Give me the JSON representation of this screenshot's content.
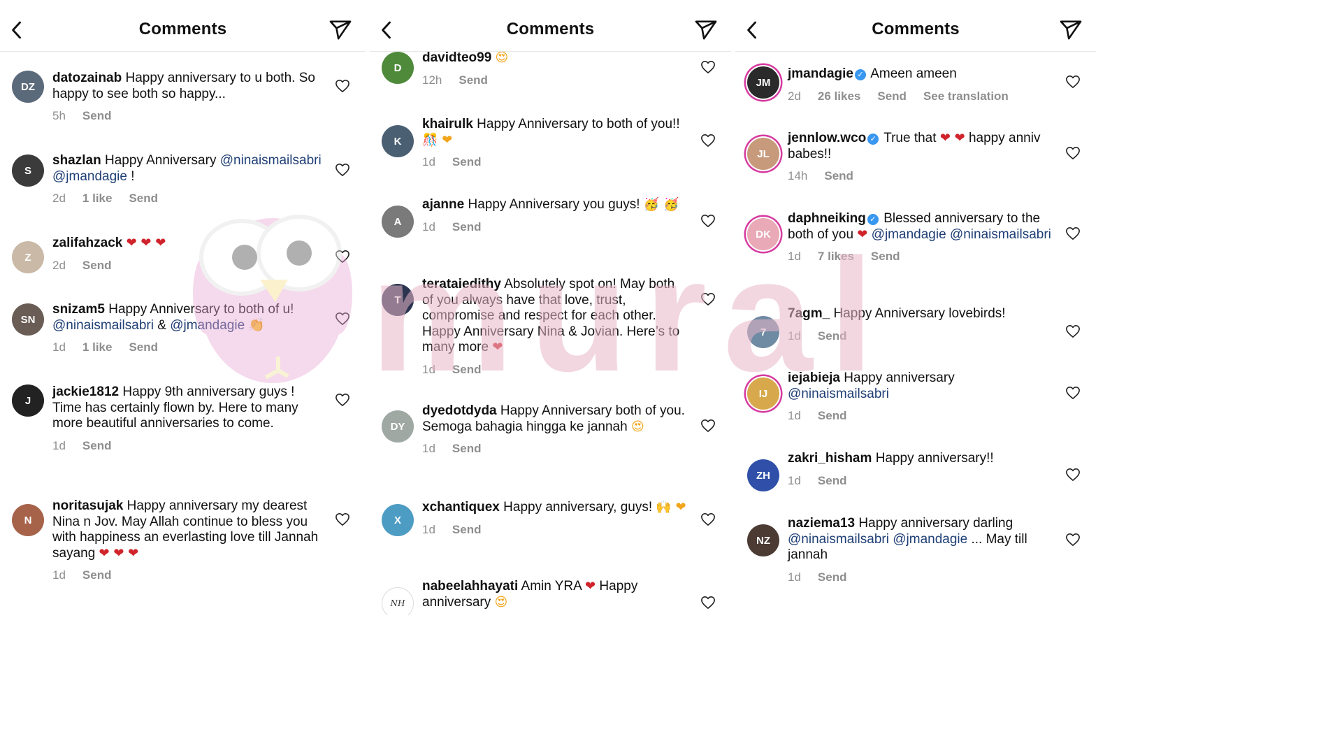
{
  "header": {
    "title": "Comments"
  },
  "panels": [
    {
      "comments": [
        {
          "user": "datozainab",
          "parts": [
            {
              "t": "Happy anniversary to u both. So happy to see both so happy..."
            }
          ],
          "meta": [
            "5h",
            "Send"
          ],
          "avatar": {
            "initials": "DZ",
            "color": "#5b6a7a"
          }
        },
        {
          "user": "shazlan",
          "parts": [
            {
              "t": "Happy Anniversary "
            },
            {
              "m": "@ninaismailsabri"
            },
            {
              "t": " "
            },
            {
              "m": "@jmandagie"
            },
            {
              "t": " !"
            }
          ],
          "meta": [
            "2d",
            "1 like",
            "Send"
          ],
          "avatar": {
            "initials": "S",
            "color": "#3b3b3b"
          }
        },
        {
          "user": "zalifahzack",
          "parts": [
            {
              "e": "❤ ❤ ❤"
            }
          ],
          "meta": [
            "2d",
            "Send"
          ],
          "avatar": {
            "initials": "Z",
            "color": "#c9b9a6"
          }
        },
        {
          "user": "snizam5",
          "parts": [
            {
              "t": "Happy Anniversary to both of u! "
            },
            {
              "m": "@ninaismailsabri"
            },
            {
              "t": " & "
            },
            {
              "m": "@jmandagie"
            },
            {
              "t": " 👏"
            }
          ],
          "meta": [
            "1d",
            "1 like",
            "Send"
          ],
          "avatar": {
            "initials": "SN",
            "color": "#6a5d55"
          }
        },
        {
          "user": "jackie1812",
          "parts": [
            {
              "t": "Happy 9th anniversary guys ! Time has certainly flown by. Here to many more beautiful anniversaries to come."
            }
          ],
          "meta": [
            "1d",
            "Send"
          ],
          "avatar": {
            "initials": "J",
            "color": "#222222"
          }
        },
        {
          "user": "noritasujak",
          "parts": [
            {
              "t": "Happy anniversary my dearest Nina n Jov. May Allah continue to bless you with happiness an everlasting love till Jannah sayang "
            },
            {
              "e": "❤ ❤ ❤"
            }
          ],
          "meta": [
            "1d",
            "Send"
          ],
          "avatar": {
            "initials": "N",
            "color": "#a6634a"
          }
        }
      ]
    },
    {
      "comments": [
        {
          "user": "davidteo99",
          "parts": [
            {
              "e": "😍"
            }
          ],
          "meta": [
            "12h",
            "Send"
          ],
          "avatar": {
            "initials": "D",
            "color": "#4f8a3b"
          }
        },
        {
          "user": "khairulk",
          "parts": [
            {
              "t": "Happy Anniversary to both of you!! "
            },
            {
              "e": "🎊 ❤"
            }
          ],
          "meta": [
            "1d",
            "Send"
          ],
          "avatar": {
            "initials": "K",
            "color": "#4a6072"
          }
        },
        {
          "user": "ajanne",
          "parts": [
            {
              "t": "Happy Anniversary you guys! "
            },
            {
              "e": "🥳 🥳"
            }
          ],
          "meta": [
            "1d",
            "Send"
          ],
          "avatar": {
            "initials": "A",
            "color": "#7a7a7a"
          }
        },
        {
          "user": "terataiedithy",
          "parts": [
            {
              "t": "Absolutely spot on! May both of you always have that love, trust, compromise and respect for each other. Happy Anniversary Nina & Jovian. Here’s to many more "
            },
            {
              "e": "❤"
            }
          ],
          "meta": [
            "1d",
            "Send"
          ],
          "avatar": {
            "initials": "T",
            "color": "#2c3550"
          }
        },
        {
          "user": "dyedotdyda",
          "parts": [
            {
              "t": "Happy Anniversary both of you. Semoga bahagia hingga ke jannah "
            },
            {
              "e": "😍"
            }
          ],
          "meta": [
            "1d",
            "Send"
          ],
          "avatar": {
            "initials": "DY",
            "color": "#9fa8a3"
          }
        },
        {
          "user": "xchantiquex",
          "parts": [
            {
              "t": "Happy anniversary, guys! "
            },
            {
              "e": "🙌 ❤"
            }
          ],
          "meta": [
            "1d",
            "Send"
          ],
          "avatar": {
            "initials": "X",
            "color": "#4d9cc4"
          }
        },
        {
          "user": "nabeelahhayati",
          "parts": [
            {
              "t": "Amin YRA "
            },
            {
              "e": "❤"
            },
            {
              "t": " Happy anniversary "
            },
            {
              "e": "😍"
            }
          ],
          "meta": [],
          "avatar": {
            "initials": "NH",
            "color": "#ffffff",
            "script": true
          }
        }
      ]
    },
    {
      "comments": [
        {
          "user": "jmandagie",
          "verified": true,
          "parts": [
            {
              "t": "Ameen ameen"
            }
          ],
          "meta": [
            "2d",
            "26 likes",
            "Send",
            "See translation"
          ],
          "avatar": {
            "initials": "JM",
            "color": "#2a2a2a",
            "ring": true
          }
        },
        {
          "user": "jennlow.wco",
          "verified": true,
          "parts": [
            {
              "t": "True that "
            },
            {
              "e": "❤ ❤"
            },
            {
              "t": " happy anniv babes!!"
            }
          ],
          "meta": [
            "14h",
            "Send"
          ],
          "avatar": {
            "initials": "JL",
            "color": "#c79a7c",
            "ring": true
          }
        },
        {
          "user": "daphneiking",
          "verified": true,
          "parts": [
            {
              "t": "Blessed anniversary to the both of you "
            },
            {
              "e": "❤"
            },
            {
              "t": " "
            },
            {
              "m": "@jmandagie"
            },
            {
              "t": " "
            },
            {
              "m": "@ninaismailsabri"
            }
          ],
          "meta": [
            "1d",
            "7 likes",
            "Send"
          ],
          "avatar": {
            "initials": "DK",
            "color": "#e9a9b6",
            "ring": true
          }
        },
        {
          "user": "7agm_",
          "parts": [
            {
              "t": "Happy Anniversary  lovebirds!"
            }
          ],
          "meta": [
            "1d",
            "Send"
          ],
          "avatar": {
            "initials": "7",
            "color": "#6f8aa3"
          }
        },
        {
          "user": "iejabieja",
          "parts": [
            {
              "t": "Happy anniversary "
            },
            {
              "m": "@ninaismailsabri"
            }
          ],
          "meta": [
            "1d",
            "Send"
          ],
          "avatar": {
            "initials": "IJ",
            "color": "#d7a94c",
            "ring": true
          }
        },
        {
          "user": "zakri_hisham",
          "parts": [
            {
              "t": "Happy anniversary!!"
            }
          ],
          "meta": [
            "1d",
            "Send"
          ],
          "avatar": {
            "initials": "ZH",
            "color": "#2f4fa8"
          }
        },
        {
          "user": "naziema13",
          "parts": [
            {
              "t": "Happy anniversary darling "
            },
            {
              "m": "@ninaismailsabri"
            },
            {
              "t": " "
            },
            {
              "m": "@jmandagie"
            },
            {
              "t": " ... May till jannah"
            }
          ],
          "meta": [
            "1d",
            "Send"
          ],
          "avatar": {
            "initials": "NZ",
            "color": "#4b3b33"
          }
        }
      ]
    }
  ],
  "watermark": {
    "text": "mural",
    "color": "#e8b7c8"
  }
}
